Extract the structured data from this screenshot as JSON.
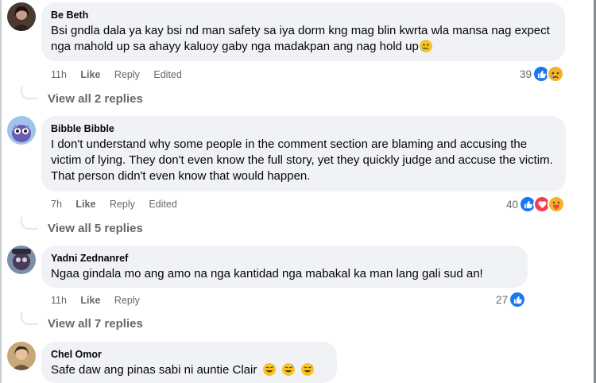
{
  "comments": [
    {
      "author": "Be Beth",
      "text": "Bsi gndla dala ya kay bsi nd man safety sa iya dorm kng mag blin kwrta wla mansa nag expect nga mahold up sa ahayy kaluoy gaby nga madakpan ang nag hold up",
      "time": "11h",
      "like": "Like",
      "reply": "Reply",
      "edited": "Edited",
      "reaction_count": "39",
      "reactions": [
        "like-icon",
        "sad-icon"
      ],
      "view_replies": "View all 2 replies"
    },
    {
      "author": "Bibble Bibble",
      "text": "I don't understand why some people in the comment section are blaming and accusing the victim of lying. They don't even know the full story, yet they quickly judge and accuse the victim. That person didn't even know that would happen.",
      "time": "7h",
      "like": "Like",
      "reply": "Reply",
      "edited": "Edited",
      "reaction_count": "40",
      "reactions": [
        "like-icon",
        "love-icon",
        "care-icon"
      ],
      "view_replies": "View all 5 replies"
    },
    {
      "author": "Yadni Zednanref",
      "text": "Ngaa gindala mo ang amo na nga kantidad nga mabakal ka man lang gali sud an!",
      "time": "11h",
      "like": "Like",
      "reply": "Reply",
      "reaction_count": "27",
      "reactions": [
        "like-icon"
      ],
      "view_replies": "View all 7 replies"
    },
    {
      "author": "Chel Omor",
      "text": "Safe daw ang pinas sabi ni auntie Clair",
      "emojis": [
        "grinning-sweat-emoji",
        "grinning-sweat-emoji",
        "grinning-sweat-emoji"
      ]
    }
  ],
  "colors": {
    "bubble": "#f0f2f5",
    "meta": "#65676b",
    "like_blue": "#1877f2",
    "love_red": "#f33e58",
    "emoji_yellow": "#f7b125"
  }
}
